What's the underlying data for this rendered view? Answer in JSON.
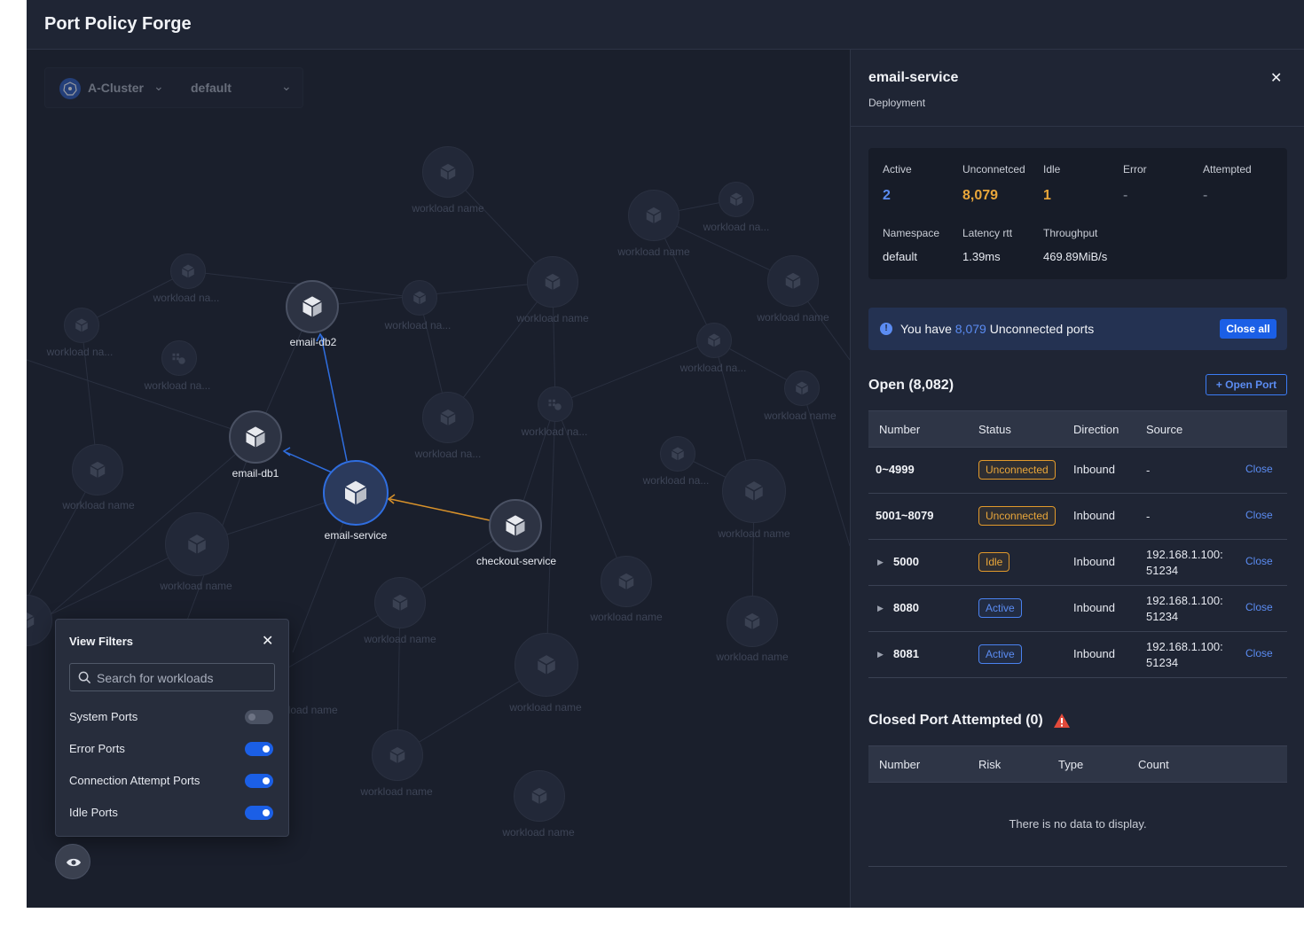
{
  "app": {
    "title": "Port Policy Forge"
  },
  "cluster_bar": {
    "cluster": "A-Cluster",
    "namespace": "default"
  },
  "graph": {
    "dim_nodes": [
      {
        "id": "d1",
        "label": "workload name"
      },
      {
        "id": "d2",
        "label": "workload na..."
      },
      {
        "id": "d3",
        "label": "workload name"
      },
      {
        "id": "d4",
        "label": "workload na..."
      },
      {
        "id": "d5",
        "label": "workload name"
      },
      {
        "id": "d6",
        "label": "workload na..."
      },
      {
        "id": "d7",
        "label": "workload name"
      },
      {
        "id": "d8",
        "label": "workload na..."
      },
      {
        "id": "d9",
        "label": "workload na..."
      },
      {
        "id": "d10",
        "label": "workload na..."
      },
      {
        "id": "d11",
        "label": "workload name"
      },
      {
        "id": "d12",
        "label": "workload na..."
      },
      {
        "id": "d13",
        "label": "workload na..."
      },
      {
        "id": "d14",
        "label": "workload name"
      },
      {
        "id": "d15",
        "label": "workload na..."
      },
      {
        "id": "d16",
        "label": "workload name"
      },
      {
        "id": "d17",
        "label": "workload name"
      },
      {
        "id": "d18",
        "label": "workload name"
      },
      {
        "id": "d19",
        "label": "workload name"
      },
      {
        "id": "d20",
        "label": "workload name"
      },
      {
        "id": "d21",
        "label": "workload name"
      },
      {
        "id": "d22",
        "label": "workload name"
      },
      {
        "id": "d23",
        "label": "workload name"
      },
      {
        "id": "d24",
        "label": "workload name"
      }
    ],
    "main_nodes": {
      "email_db2": "email-db2",
      "email_db1": "email-db1",
      "email_service": "email-service",
      "checkout_service": "checkout-service"
    }
  },
  "filters": {
    "title": "View Filters",
    "search_placeholder": "Search for workloads",
    "items": [
      {
        "label": "System Ports",
        "enabled": false
      },
      {
        "label": "Error Ports",
        "enabled": true
      },
      {
        "label": "Connection Attempt Ports",
        "enabled": true
      },
      {
        "label": "Idle Ports",
        "enabled": true
      }
    ]
  },
  "panel": {
    "name": "email-service",
    "kind": "Deployment",
    "stats": {
      "active_label": "Active",
      "active_value": "2",
      "unconnected_label": "Unconnetced",
      "unconnected_value": "8,079",
      "idle_label": "Idle",
      "idle_value": "1",
      "error_label": "Error",
      "error_value": "-",
      "attempted_label": "Attempted",
      "attempted_value": "-",
      "namespace_label": "Namespace",
      "namespace_value": "default",
      "latency_label": "Latency rtt",
      "latency_value": "1.39ms",
      "throughput_label": "Throughput",
      "throughput_value": "469.89MiB/s"
    },
    "notice": {
      "prefix": "You have",
      "count": "8,079",
      "suffix": "Unconnected ports",
      "button": "Close all"
    },
    "open_section": {
      "title": "Open (8,082)",
      "button": "+ Open Port",
      "columns": [
        "Number",
        "Status",
        "Direction",
        "Source"
      ],
      "rows": [
        {
          "number": "0~4999",
          "status": "Unconnected",
          "direction": "Inbound",
          "source": "-",
          "action": "Close"
        },
        {
          "number": "5001~8079",
          "status": "Unconnected",
          "direction": "Inbound",
          "source": "-",
          "action": "Close"
        },
        {
          "number": "5000",
          "status": "Idle",
          "direction": "Inbound",
          "source": "192.168.1.100:",
          "source2": "51234",
          "action": "Close"
        },
        {
          "number": "8080",
          "status": "Active",
          "direction": "Inbound",
          "source": "192.168.1.100:",
          "source2": "51234",
          "action": "Close"
        },
        {
          "number": "8081",
          "status": "Active",
          "direction": "Inbound",
          "source": "192.168.1.100:",
          "source2": "51234",
          "action": "Close"
        }
      ]
    },
    "closed_section": {
      "title": "Closed Port Attempted (0)",
      "columns": [
        "Number",
        "Risk",
        "Type",
        "Count"
      ],
      "empty": "There is no data to display."
    }
  },
  "colors": {
    "accent": "#1b5fe6",
    "link": "#5b8cf2",
    "warning": "#e9a63a",
    "danger": "#e24a3b",
    "background": "#1a1f2c"
  },
  "icons": {
    "cluster": "kubernetes-icon",
    "node": "cube-icon",
    "search": "search-icon",
    "view": "eye-icon",
    "info": "info-icon",
    "warning": "warning-triangle-icon"
  }
}
